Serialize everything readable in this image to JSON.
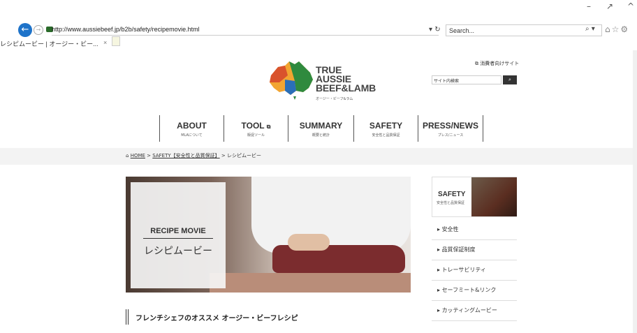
{
  "browser": {
    "url": "http://www.aussiebeef.jp/b2b/safety/recipemovie.html",
    "search_placeholder": "Search...",
    "tab_title": "レシピムービー | オージー・ビー...",
    "tab_close": "×",
    "window_controls": [
      "–",
      "↗",
      "^"
    ]
  },
  "header": {
    "logo_lines": [
      "TRUE",
      "AUSSIE",
      "BEEF&LAMB"
    ],
    "logo_sub": "オージー・ビーフ&ラム",
    "consumer_link": "消費者向けサイト",
    "site_search_placeholder": "サイト内検索"
  },
  "nav": [
    {
      "en": "ABOUT",
      "jp": "MLAについて"
    },
    {
      "en": "TOOL",
      "jp": "販促ツール"
    },
    {
      "en": "SUMMARY",
      "jp": "概要と統計"
    },
    {
      "en": "SAFETY",
      "jp": "安全性と品質保証"
    },
    {
      "en": "PRESS/NEWS",
      "jp": "プレス/ニュース"
    }
  ],
  "breadcrumb": {
    "home": "HOME",
    "safety": "SAFETY【安全性と品質保証】",
    "current": "レシピムービー",
    "sep": " > "
  },
  "hero": {
    "title_en": "RECIPE MOVIE",
    "title_jp": "レシピムービー"
  },
  "sidebar": {
    "head_title": "SAFETY",
    "head_sub": "安全性と品質保証",
    "items": [
      "安全性",
      "品質保証制度",
      "トレーサビリティ",
      "セーフミート&リンク",
      "カッティングムービー"
    ]
  },
  "section_title": "フレンチシェフのオススメ オージー・ビーフレシピ"
}
